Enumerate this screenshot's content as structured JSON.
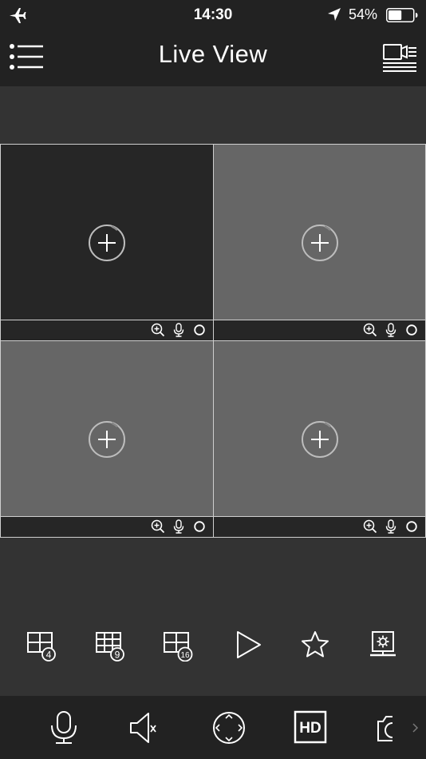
{
  "status_bar": {
    "time": "14:30",
    "battery_percent": "54%",
    "battery_level": 0.54,
    "airplane_mode": true,
    "location_active": true
  },
  "nav": {
    "title": "Live View",
    "left_icon": "menu-list-icon",
    "right_icon": "camera-list-icon"
  },
  "grid": {
    "layout": "2x2",
    "cells": [
      {
        "id": 1,
        "state": "empty",
        "background": "#262626",
        "selected": true
      },
      {
        "id": 2,
        "state": "empty",
        "background": "#666666",
        "selected": false
      },
      {
        "id": 3,
        "state": "empty",
        "background": "#666666",
        "selected": false
      },
      {
        "id": 4,
        "state": "empty",
        "background": "#666666",
        "selected": false
      }
    ],
    "cell_bar_icons": [
      "zoom-in-icon",
      "microphone-icon",
      "record-icon"
    ]
  },
  "toolbar": {
    "layout_4_label": "4",
    "layout_9_label": "9",
    "layout_16_label": "16",
    "items": [
      "layout-4-icon",
      "layout-9-icon",
      "layout-16-icon",
      "playback-icon",
      "favorites-icon",
      "remote-config-icon"
    ]
  },
  "bottom_bar": {
    "hd_label": "HD",
    "items": [
      "talk-icon",
      "mute-icon",
      "ptz-icon",
      "hd-icon",
      "snapshot-icon"
    ]
  },
  "colors": {
    "bar_background": "#222222",
    "page_background": "#333333",
    "cell_border": "#cfcfcf",
    "icon": "#ffffff"
  }
}
